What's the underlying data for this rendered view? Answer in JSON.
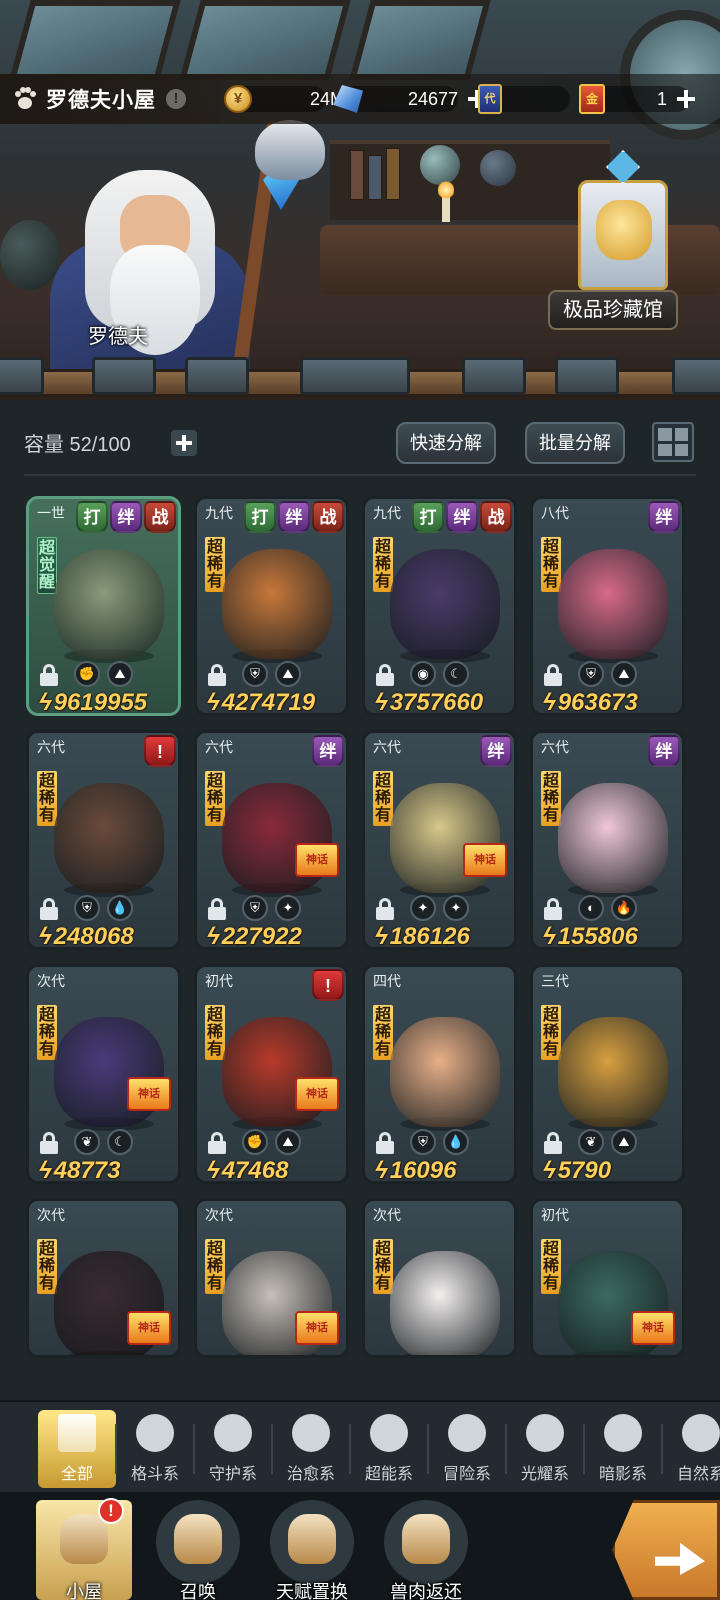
{
  "header": {
    "title": "罗德夫小屋",
    "info_icon": "!",
    "resources": [
      {
        "icon": "coin-icon",
        "value": "24M",
        "has_plus": false
      },
      {
        "icon": "crystal-icon",
        "value": "24677",
        "has_plus": true
      },
      {
        "icon": "card-icon",
        "icon_text": "代",
        "value": "0",
        "has_plus": false
      },
      {
        "icon": "ticket-icon",
        "icon_text": "金",
        "value": "1",
        "has_plus": true
      }
    ]
  },
  "scene": {
    "npc_name": "罗德夫",
    "gallery_label": "极品珍藏馆"
  },
  "inventory": {
    "capacity_label": "容量 52/100",
    "quick_decompose": "快速分解",
    "batch_decompose": "批量分解"
  },
  "pets": [
    {
      "gen": "一世",
      "tags": [
        "打",
        "绊",
        "战"
      ],
      "rarity": "超觉醒",
      "power": "9619955",
      "elements": [
        "fist-icon",
        "earth-icon"
      ],
      "color": "#8a9a7a",
      "style": "green"
    },
    {
      "gen": "九代",
      "tags": [
        "打",
        "绊",
        "战"
      ],
      "rarity": "超稀有",
      "power": "4274719",
      "elements": [
        "shield-icon",
        "earth-icon"
      ],
      "color": "#c8783a"
    },
    {
      "gen": "九代",
      "tags": [
        "打",
        "绊",
        "战"
      ],
      "rarity": "超稀有",
      "power": "3757660",
      "elements": [
        "eye-icon",
        "moon-icon"
      ],
      "color": "#4a3a6a"
    },
    {
      "gen": "八代",
      "tags": [
        "绊"
      ],
      "rarity": "超稀有",
      "power": "963673",
      "elements": [
        "shield-icon",
        "earth-icon"
      ],
      "color": "#d86a8a"
    },
    {
      "gen": "六代",
      "tags": [
        "!"
      ],
      "rarity": "超稀有",
      "power": "248068",
      "elements": [
        "shield-icon",
        "water-icon"
      ],
      "color": "#6a4a3a"
    },
    {
      "gen": "六代",
      "tags": [
        "绊"
      ],
      "rarity": "超稀有",
      "power": "227922",
      "elements": [
        "shield-icon",
        "light-icon"
      ],
      "color": "#8a2a3a",
      "badge": "神话"
    },
    {
      "gen": "六代",
      "tags": [
        "绊"
      ],
      "rarity": "超稀有",
      "power": "186126",
      "elements": [
        "light-icon",
        "light-icon"
      ],
      "color": "#d8c88a",
      "badge": "神话"
    },
    {
      "gen": "六代",
      "tags": [
        "绊"
      ],
      "rarity": "超稀有",
      "power": "155806",
      "elements": [
        "psychic-icon",
        "fire-icon"
      ],
      "color": "#f0c8d8"
    },
    {
      "gen": "次代",
      "tags": [],
      "rarity": "超稀有",
      "power": "48773",
      "elements": [
        "leaf-icon",
        "moon-icon"
      ],
      "color": "#4a3a7a",
      "badge": "神话"
    },
    {
      "gen": "初代",
      "tags": [
        "!"
      ],
      "rarity": "超稀有",
      "power": "47468",
      "elements": [
        "fist-icon",
        "earth-icon"
      ],
      "color": "#b83a2a",
      "badge": "神话"
    },
    {
      "gen": "四代",
      "tags": [],
      "rarity": "超稀有",
      "power": "16096",
      "elements": [
        "shield-icon",
        "water-icon"
      ],
      "color": "#e8b088"
    },
    {
      "gen": "三代",
      "tags": [],
      "rarity": "超稀有",
      "power": "5790",
      "elements": [
        "leaf-icon",
        "earth-icon"
      ],
      "color": "#d8a040"
    },
    {
      "gen": "次代",
      "tags": [],
      "rarity": "超稀有",
      "power": "",
      "elements": [],
      "color": "#3a2a32",
      "badge": "神话"
    },
    {
      "gen": "次代",
      "tags": [],
      "rarity": "超稀有",
      "power": "",
      "elements": [],
      "color": "#c8c0b8",
      "badge": "神话"
    },
    {
      "gen": "次代",
      "tags": [],
      "rarity": "超稀有",
      "power": "",
      "elements": [],
      "color": "#f4f0f0"
    },
    {
      "gen": "初代",
      "tags": [],
      "rarity": "超稀有",
      "power": "",
      "elements": [],
      "color": "#3a6a60",
      "badge": "神话"
    }
  ],
  "categories": [
    {
      "label": "全部",
      "icon": "all-icon",
      "active": true
    },
    {
      "label": "格斗系",
      "icon": "fist-icon"
    },
    {
      "label": "守护系",
      "icon": "shield-icon"
    },
    {
      "label": "治愈系",
      "icon": "sprout-icon"
    },
    {
      "label": "超能系",
      "icon": "alien-icon"
    },
    {
      "label": "冒险系",
      "icon": "lantern-icon"
    },
    {
      "label": "光耀系",
      "icon": "star-icon"
    },
    {
      "label": "暗影系",
      "icon": "eye-icon"
    },
    {
      "label": "自然系",
      "icon": "leaf-icon"
    }
  ],
  "bottom_nav": [
    {
      "label": "小屋",
      "icon": "house-icon",
      "active": true,
      "alert": "!"
    },
    {
      "label": "召唤",
      "icon": "egg-icon"
    },
    {
      "label": "天赋置换",
      "icon": "swap-icon"
    },
    {
      "label": "兽肉返还",
      "icon": "meat-icon"
    }
  ],
  "colors": {
    "accent": "#ffd05a",
    "panel": "#1e262a",
    "active_tab": "#e8c060"
  }
}
